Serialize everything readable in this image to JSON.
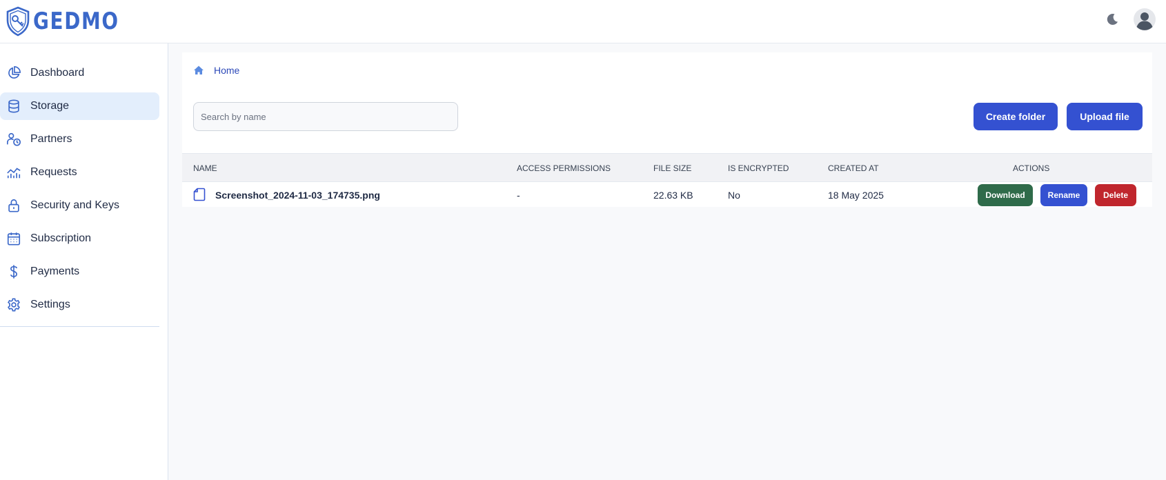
{
  "app": {
    "logo_text": "GEDMO"
  },
  "header": {
    "theme_icon": "moon-icon",
    "user_icon": "user-avatar-icon"
  },
  "sidebar": {
    "items": [
      {
        "label": "Dashboard",
        "icon": "pie-chart-icon",
        "active": false
      },
      {
        "label": "Storage",
        "icon": "database-icon",
        "active": true
      },
      {
        "label": "Partners",
        "icon": "partners-clock-icon",
        "active": false
      },
      {
        "label": "Requests",
        "icon": "line-chart-icon",
        "active": false
      },
      {
        "label": "Security and Keys",
        "icon": "lock-icon",
        "active": false
      },
      {
        "label": "Subscription",
        "icon": "calendar-icon",
        "active": false
      },
      {
        "label": "Payments",
        "icon": "dollar-icon",
        "active": false
      },
      {
        "label": "Settings",
        "icon": "gear-icon",
        "active": false
      }
    ]
  },
  "breadcrumb": {
    "home_label": "Home"
  },
  "search": {
    "placeholder": "Search by name",
    "value": ""
  },
  "toolbar": {
    "create_folder_label": "Create folder",
    "upload_file_label": "Upload file"
  },
  "table": {
    "columns": [
      "NAME",
      "ACCESS PERMISSIONS",
      "FILE SIZE",
      "IS ENCRYPTED",
      "CREATED AT",
      "ACTIONS"
    ],
    "rows": [
      {
        "name": "Screenshot_2024-11-03_174735.png",
        "access_permissions": "-",
        "file_size": "22.63 KB",
        "is_encrypted": "No",
        "created_at": "18 May 2025",
        "actions": {
          "download": "Download",
          "rename": "Rename",
          "delete": "Delete"
        }
      }
    ]
  },
  "colors": {
    "brand": "#3b68c9",
    "primary_button": "#3451d1",
    "download_button": "#2f6b4a",
    "delete_button": "#c0262d",
    "active_nav_bg": "#e3eefc"
  }
}
